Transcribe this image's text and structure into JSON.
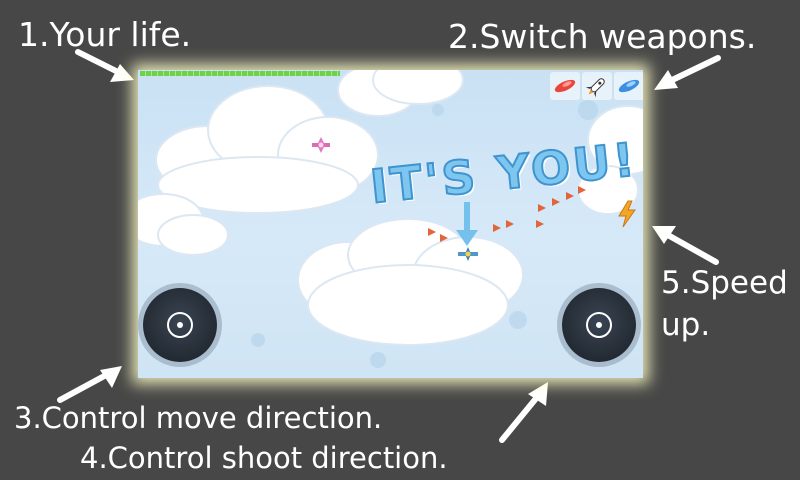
{
  "captions": {
    "life": "1.Your life.",
    "weapons": "2.Switch weapons.",
    "move": "3.Control move direction.",
    "shoot": "4.Control shoot direction.",
    "speed_line1": "5.Speed",
    "speed_line2": "up."
  },
  "game": {
    "banner_text": "IT'S YOU!",
    "life_fraction": 0.4,
    "weapons": [
      "red-bullet-icon",
      "rocket-icon",
      "blue-bullet-icon"
    ],
    "colors": {
      "sky": "#d6e9f8",
      "life_bar": "#6fd04a",
      "banner": "#7cc6ef",
      "frame_glow": "#ffffc8",
      "page_bg": "#474747"
    }
  }
}
